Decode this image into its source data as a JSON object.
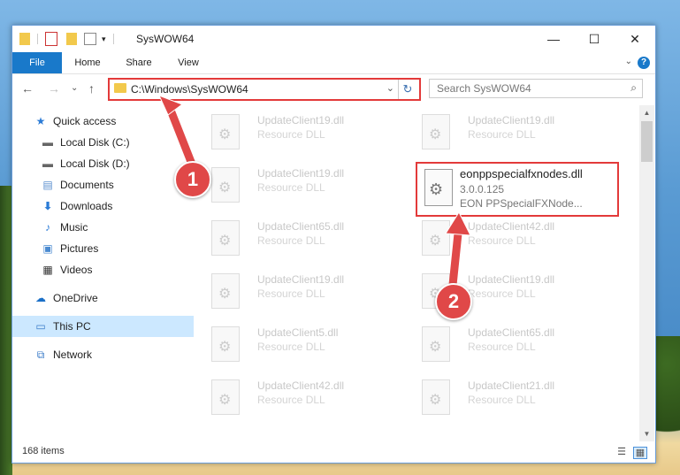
{
  "window": {
    "title": "SysWOW64",
    "controls": {
      "minimize": "—",
      "maximize": "☐",
      "close": "✕"
    }
  },
  "ribbon": {
    "tabs": [
      {
        "label": "File"
      },
      {
        "label": "Home"
      },
      {
        "label": "Share"
      },
      {
        "label": "View"
      }
    ],
    "help": "?",
    "collapse": "⌄"
  },
  "nav": {
    "back": "←",
    "forward": "→",
    "recent": "⌄",
    "up": "↑",
    "address": "C:\\Windows\\SysWOW64",
    "address_dropdown": "⌄",
    "refresh": "↻",
    "search_placeholder": "Search SysWOW64",
    "search_icon": "⌕"
  },
  "sidebar": {
    "items": [
      {
        "label": "Quick access",
        "icon": "star-icon",
        "pinned": false
      },
      {
        "label": "Local Disk (C:)",
        "icon": "drive-icon",
        "pinned": true
      },
      {
        "label": "Local Disk (D:)",
        "icon": "drive-icon",
        "pinned": true
      },
      {
        "label": "Documents",
        "icon": "documents-icon",
        "pinned": true
      },
      {
        "label": "Downloads",
        "icon": "downloads-icon",
        "pinned": true
      },
      {
        "label": "Music",
        "icon": "music-icon",
        "pinned": true
      },
      {
        "label": "Pictures",
        "icon": "pictures-icon",
        "pinned": true
      },
      {
        "label": "Videos",
        "icon": "videos-icon",
        "pinned": true
      },
      {
        "label": "OneDrive",
        "icon": "cloud-icon",
        "pinned": false
      },
      {
        "label": "This PC",
        "icon": "computer-icon",
        "pinned": false,
        "selected": true
      },
      {
        "label": "Network",
        "icon": "network-icon",
        "pinned": false
      }
    ]
  },
  "files": {
    "left_column": [
      {
        "name": "UpdateClient19.dll",
        "type": "Resource DLL"
      },
      {
        "name": "UpdateClient19.dll",
        "type": "Resource DLL"
      },
      {
        "name": "UpdateClient65.dll",
        "type": "Resource DLL"
      },
      {
        "name": "UpdateClient19.dll",
        "type": "Resource DLL"
      },
      {
        "name": "UpdateClient5.dll",
        "type": "Resource DLL"
      },
      {
        "name": "UpdateClient42.dll",
        "type": "Resource DLL"
      }
    ],
    "right_column": [
      {
        "name": "UpdateClient19.dll",
        "type": "Resource DLL"
      },
      {
        "name": "",
        "type": ""
      },
      {
        "name": "UpdateClient42.dll",
        "type": "Resource DLL"
      },
      {
        "name": "UpdateClient19.dll",
        "type": "Resource DLL"
      },
      {
        "name": "UpdateClient65.dll",
        "type": "Resource DLL"
      },
      {
        "name": "UpdateClient21.dll",
        "type": "Resource DLL"
      }
    ],
    "highlighted": {
      "name": "eonppspecialfxnodes.dll",
      "version": "3.0.0.125",
      "description": "EON PPSpecialFXNode..."
    }
  },
  "status": {
    "item_count": "168 items"
  },
  "annotations": {
    "step1": "1",
    "step2": "2"
  },
  "colors": {
    "accent": "#1979ca",
    "highlight": "#e33a3a"
  }
}
